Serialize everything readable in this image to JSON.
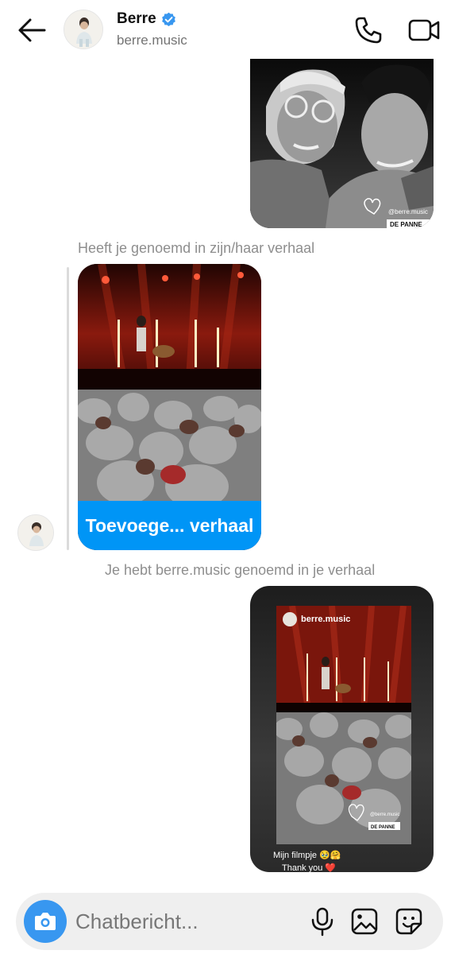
{
  "header": {
    "back_icon": "arrow-left-icon",
    "name": "Berre",
    "username": "berre.music",
    "verified": true,
    "verified_color": "#3897f0",
    "call_icon": "phone-icon",
    "video_icon": "video-camera-icon"
  },
  "messages": {
    "story_reply_overlay": {
      "handle": "@berre.music",
      "location": "DE PANNE"
    },
    "mention_notice": "Heeft je genoemd in zijn/haar verhaal",
    "add_to_story_label": "Toevoege... verhaal",
    "mentioned_notice": "Je hebt berre.music genoemd in je verhaal",
    "own_story": {
      "username": "berre.music",
      "handle": "@berre.music",
      "location": "DE PANNE",
      "caption_line1": "Mijn filmpje 🥹🤗",
      "caption_line2": "Thank you ❤️"
    }
  },
  "composer": {
    "placeholder": "Chatbericht...",
    "camera_icon": "camera-icon",
    "mic_icon": "microphone-icon",
    "gallery_icon": "image-icon",
    "sticker_icon": "sticker-icon"
  },
  "colors": {
    "accent": "#0095f6",
    "camera_button": "#3897f0",
    "system_text": "#8e8e8e"
  }
}
